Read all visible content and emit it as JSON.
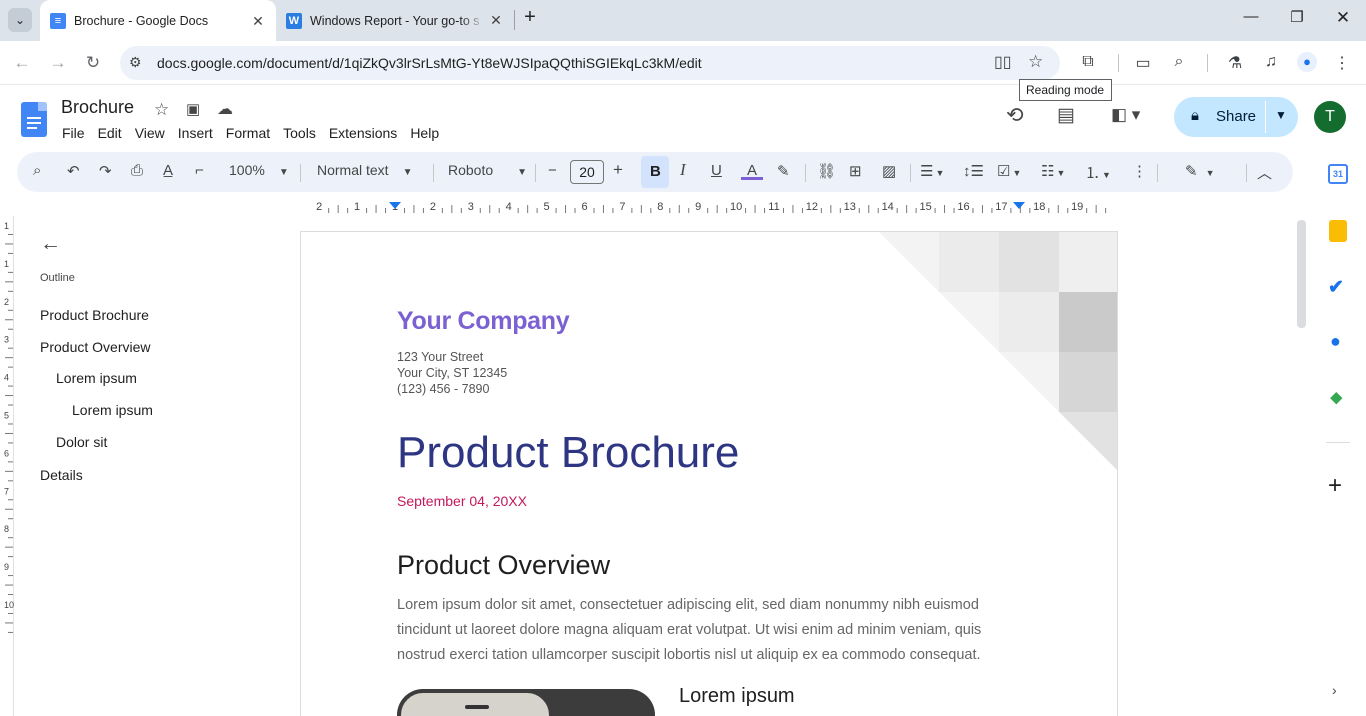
{
  "browser": {
    "tabs": [
      {
        "title": "Brochure - Google Docs",
        "active": true
      },
      {
        "title": "Windows Report - Your go-to s",
        "active": false
      }
    ],
    "url": "docs.google.com/document/d/1qiZkQv3lrSrLsMtG-Yt8eWJSIpaQQthiSGIEkqLc3kM/edit",
    "tooltip": "Reading mode",
    "icons": [
      "tab-search-icon",
      "new-tab-icon",
      "minimize-icon",
      "maximize-icon",
      "close-icon",
      "back-icon",
      "forward-icon",
      "reload-icon",
      "site-info-icon",
      "reading-mode-icon",
      "bookmark-star-icon",
      "extensions-icon",
      "reading-list-icon",
      "search-icon",
      "labs-icon",
      "media-icon",
      "profile-icon",
      "menu-icon"
    ]
  },
  "docs": {
    "title": "Brochure",
    "menu": [
      "File",
      "Edit",
      "View",
      "Insert",
      "Format",
      "Tools",
      "Extensions",
      "Help"
    ],
    "share_label": "Share",
    "avatar_initial": "T"
  },
  "format_toolbar": {
    "zoom": "100%",
    "style": "Normal text",
    "font": "Roboto",
    "font_size": "20",
    "minus": "−",
    "plus": "+"
  },
  "ruler": {
    "labels": [
      "2",
      "1",
      "1",
      "2",
      "3",
      "4",
      "5",
      "6",
      "7",
      "8",
      "9",
      "10",
      "11",
      "12",
      "13",
      "14",
      "15",
      "16",
      "17",
      "18",
      "19"
    ],
    "vertical_labels": [
      "2",
      "1",
      "1",
      "2",
      "3",
      "4",
      "5",
      "6",
      "7",
      "8",
      "9",
      "10"
    ]
  },
  "outline": {
    "heading": "Outline",
    "items": [
      {
        "label": "Product Brochure",
        "level": 1
      },
      {
        "label": "Product Overview",
        "level": 1
      },
      {
        "label": "Lorem ipsum",
        "level": 2
      },
      {
        "label": "Lorem ipsum",
        "level": 3
      },
      {
        "label": "Dolor sit",
        "level": 2
      },
      {
        "label": "Details",
        "level": 1
      }
    ]
  },
  "document": {
    "company": "Your Company",
    "address": [
      "123 Your Street",
      "Your City, ST 12345",
      "(123) 456 - 7890"
    ],
    "title": "Product Brochure",
    "date": "September 04, 20XX",
    "overview_heading": "Product Overview",
    "overview_body": "Lorem ipsum dolor sit amet, consectetuer adipiscing elit, sed diam nonummy nibh euismod tincidunt ut laoreet dolore magna aliquam erat volutpat. Ut wisi enim ad minim veniam, quis nostrud exerci tation ullamcorper suscipit lobortis nisl ut aliquip ex ea commodo consequat.",
    "lorem_heading": "Lorem ipsum"
  },
  "colors": {
    "company": "#7b61d1",
    "title": "#2e3683",
    "date": "#c2185b",
    "share_bg": "#c2e7ff",
    "avatar_bg": "#146c2e"
  }
}
